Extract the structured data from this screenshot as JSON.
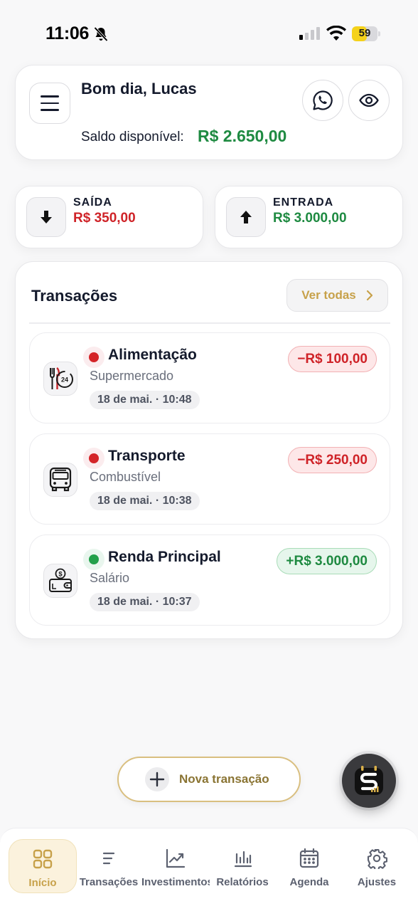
{
  "status_bar": {
    "time": "11:06",
    "battery": "59",
    "battery_level": 0.59
  },
  "header": {
    "greeting": "Bom dia, Lucas",
    "balance_label": "Saldo disponível:",
    "balance_value": "R$ 2.650,00"
  },
  "summary": {
    "out": {
      "label": "SAÍDA",
      "value": "R$ 350,00"
    },
    "in": {
      "label": "ENTRADA",
      "value": "R$ 3.000,00"
    }
  },
  "transactions": {
    "title": "Transações",
    "see_all": "Ver todas",
    "items": [
      {
        "category": "Alimentação",
        "description": "Supermercado",
        "date": "18 de mai. · 10:48",
        "amount": "−R$ 100,00",
        "icon": "food-24h-icon"
      },
      {
        "category": "Transporte",
        "description": "Combustível",
        "date": "18 de mai. · 10:38",
        "amount": "−R$ 250,00",
        "icon": "bus-icon"
      },
      {
        "category": "Renda Principal",
        "description": "Salário",
        "date": "18 de mai. · 10:37",
        "amount": "+R$ 3.000,00",
        "icon": "wallet-dollar-icon"
      }
    ]
  },
  "actions": {
    "new_transaction": "Nova transação"
  },
  "tabs": [
    {
      "label": "Início",
      "icon": "grid-icon"
    },
    {
      "label": "Transações",
      "icon": "list-icon"
    },
    {
      "label": "Investimentos",
      "icon": "chart-up-icon"
    },
    {
      "label": "Relatórios",
      "icon": "bars-icon"
    },
    {
      "label": "Agenda",
      "icon": "calendar-icon"
    },
    {
      "label": "Ajustes",
      "icon": "gear-icon"
    }
  ],
  "colors": {
    "positive": "#1e8a41",
    "negative": "#cf2328",
    "accent_gold": "#c7a14a",
    "text_dark": "#141a2c"
  }
}
